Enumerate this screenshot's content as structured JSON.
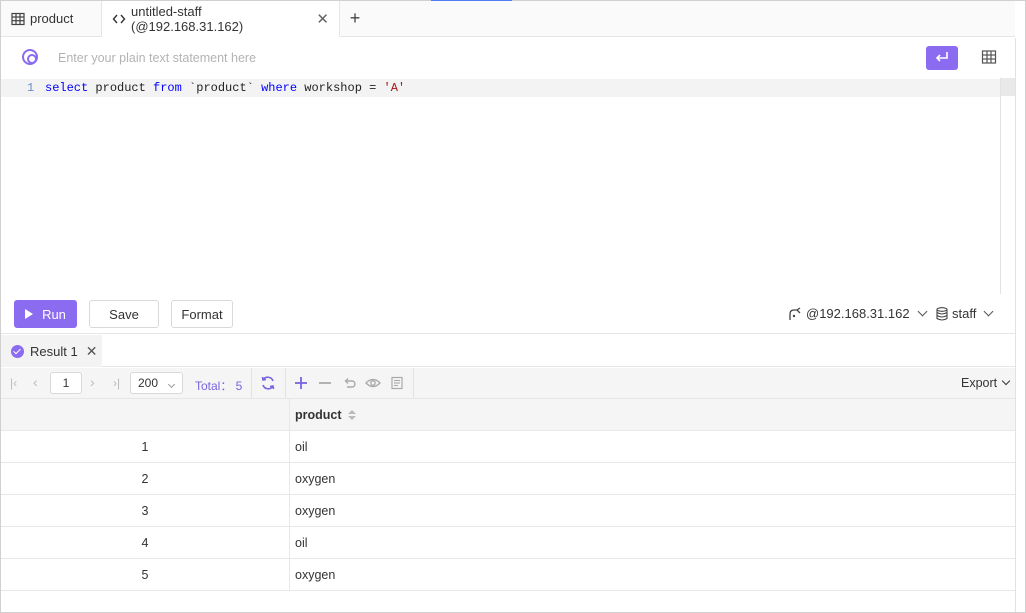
{
  "tabs": [
    {
      "label": "product",
      "icon": "table-icon"
    },
    {
      "label": "untitled-staff (@192.168.31.162)",
      "icon": "code-icon",
      "active": true
    }
  ],
  "nl_prompt": {
    "placeholder": "Enter your plain text statement here"
  },
  "editor": {
    "line_number": "1",
    "tokens": {
      "select": "select",
      "col": " product ",
      "from": "from",
      "table": " `product` ",
      "where": "where",
      "cond": " workshop = ",
      "value": "'A'"
    }
  },
  "actions": {
    "run": "Run",
    "save": "Save",
    "format": "Format",
    "connection": "@192.168.31.162",
    "database": "staff"
  },
  "result_tab": {
    "label": "Result 1"
  },
  "pager": {
    "page": "1",
    "page_size": "200",
    "total": "Total： 5",
    "export": "Export"
  },
  "table": {
    "header": "product",
    "rows": [
      {
        "index": "1",
        "value": "oil"
      },
      {
        "index": "2",
        "value": "oxygen"
      },
      {
        "index": "3",
        "value": "oxygen"
      },
      {
        "index": "4",
        "value": "oil"
      },
      {
        "index": "5",
        "value": "oxygen"
      }
    ]
  },
  "colors": {
    "accent": "#8b6cf0",
    "keyword": "#0000ff",
    "string": "#a31515"
  }
}
